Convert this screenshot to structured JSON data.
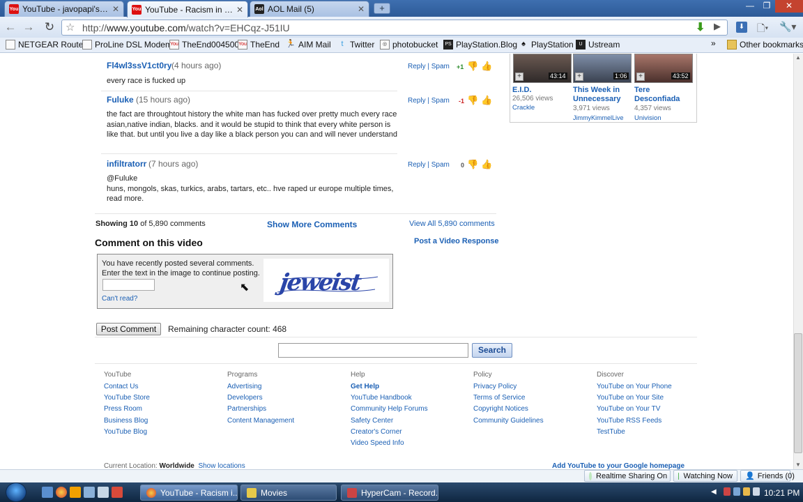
{
  "tabs": [
    {
      "title": "YouTube - javopapi's Ch...",
      "active": false
    },
    {
      "title": "YouTube - Racism in the ...",
      "active": true
    },
    {
      "title": "AOL Mail (5)",
      "active": false
    }
  ],
  "new_tab_label": "+",
  "url": {
    "prefix": "http://",
    "host": "www.youtube.com",
    "path": "/watch?v=EHCqz-J51IU"
  },
  "bookmarks": [
    "NETGEAR Router",
    "ProLine DSL Modem",
    "TheEnd004500",
    "TheEnd",
    "AIM Mail",
    "Twitter",
    "photobucket",
    "PlayStation.Blog",
    "PlayStation",
    "Ustream"
  ],
  "other_bookmarks": "Other bookmarks",
  "comments": [
    {
      "user": "Fl4wl3ssV1ct0ry",
      "time": "(4 hours ago)",
      "text": "every race is fucked up",
      "score": "+1",
      "score_color": "#2a8a2a"
    },
    {
      "user": "Fuluke",
      "time": "(15 hours ago)",
      "text": "the fact are throughtout history the white man has fucked over pretty much every race asian,native indian, blacks. and it would be stupid to think that every white person is like that. but until you live a day like a black person you can and will never understand",
      "score": "-1",
      "score_color": "#cc2222"
    },
    {
      "user": "infiltratorr",
      "time": "(7 hours ago)",
      "text": "@Fuluke\nhuns, mongols, skas, turkics, arabs, tartars, etc.. hve raped ur europe multiple times, read more.",
      "score": "0",
      "score_color": "#555555"
    }
  ],
  "comment_actions": {
    "reply": "Reply",
    "sep": "|",
    "spam": "Spam"
  },
  "showing": {
    "prefix": "Showing",
    "count": "10",
    "suffix": "of 5,890 comments"
  },
  "show_more": "Show More Comments",
  "view_all": "View All 5,890 comments",
  "comment_heading": "Comment on this video",
  "post_response": "Post a Video Response",
  "captcha": {
    "message_line1": "You have recently posted several comments.",
    "message_line2": "Enter the text in the image to continue posting.",
    "cant_read": "Can't read?",
    "word": "jeweist"
  },
  "post_comment": "Post Comment",
  "remaining": "Remaining character count: 468",
  "search_button": "Search",
  "related": [
    {
      "title": "E.I.D.",
      "duration": "43:14",
      "views": "26,506 views",
      "channel": "Crackle"
    },
    {
      "title": "This Week in Unnecessary",
      "duration": "1:06",
      "views": "3,971 views",
      "channel": "JimmyKimmelLive"
    },
    {
      "title": "Tere Desconfiada",
      "duration": "43:52",
      "views": "4,357 views",
      "channel": "Univision"
    }
  ],
  "footer": [
    {
      "title": "YouTube",
      "links": [
        "Contact Us",
        "YouTube Store",
        "Press Room",
        "Business Blog",
        "YouTube Blog"
      ]
    },
    {
      "title": "Programs",
      "links": [
        "Advertising",
        "Developers",
        "Partnerships",
        "Content Management"
      ]
    },
    {
      "title": "Help",
      "links": [
        "Get Help",
        "YouTube Handbook",
        "Community Help Forums",
        "Safety Center",
        "Creator's Corner",
        "Video Speed Info"
      ]
    },
    {
      "title": "Policy",
      "links": [
        "Privacy Policy",
        "Terms of Service",
        "Copyright Notices",
        "Community Guidelines"
      ]
    },
    {
      "title": "Discover",
      "links": [
        "YouTube on Your Phone",
        "YouTube on Your Site",
        "YouTube on Your TV",
        "YouTube RSS Feeds",
        "TestTube"
      ]
    }
  ],
  "location": {
    "label": "Current Location:",
    "value": "Worldwide",
    "show": "Show locations"
  },
  "add_google": "Add YouTube to your Google homepage",
  "status": {
    "sharing": "Realtime Sharing On",
    "watching": "Watching Now",
    "friends": "Friends (0)"
  },
  "taskbar": {
    "tasks": [
      {
        "label": "YouTube - Racism i...",
        "active": true,
        "color": "#e8a23a"
      },
      {
        "label": "Movies",
        "active": false,
        "color": "#e6c94a"
      },
      {
        "label": "HyperCam - Record...",
        "active": false,
        "color": "#c44"
      }
    ],
    "clock": "10:21 PM"
  },
  "colors": {
    "link": "#1a5fb4",
    "positive": "#2a8a2a",
    "negative": "#cc2222"
  }
}
